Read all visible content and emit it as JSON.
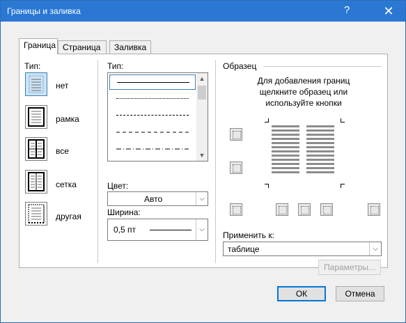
{
  "window": {
    "title": "Границы и заливка",
    "help_glyph": "?",
    "close_glyph": "✕"
  },
  "tabs": [
    {
      "label": "Граница",
      "active": true
    },
    {
      "label": "Страница",
      "active": false
    },
    {
      "label": "Заливка",
      "active": false
    }
  ],
  "setting": {
    "header": "Тип:",
    "items": [
      {
        "label": "нет",
        "icon": "border-none-icon",
        "selected": true
      },
      {
        "label": "рамка",
        "icon": "border-box-icon",
        "selected": false
      },
      {
        "label": "все",
        "icon": "border-all-icon",
        "selected": false
      },
      {
        "label": "сетка",
        "icon": "border-grid-icon",
        "selected": false
      },
      {
        "label": "другая",
        "icon": "border-custom-icon",
        "selected": false
      }
    ]
  },
  "style": {
    "header": "Тип:",
    "styles": [
      "solid",
      "dotted",
      "dashed-small",
      "dashed",
      "dash-dot"
    ],
    "selected_style": "solid"
  },
  "color": {
    "label": "Цвет:",
    "value": "Авто"
  },
  "width": {
    "label": "Ширина:",
    "value": "0,5 пт"
  },
  "preview": {
    "header": "Образец",
    "instruction_lines": [
      "Для добавления границ",
      "щелкните образец или",
      "используйте кнопки"
    ]
  },
  "apply_to": {
    "label": "Применить к:",
    "value": "таблице"
  },
  "buttons": {
    "options": "Параметры...",
    "ok": "ОК",
    "cancel": "Отмена"
  },
  "colors": {
    "titlebar": "#2b78d4",
    "selection": "#cce4f7",
    "accent_border": "#0078d7"
  }
}
